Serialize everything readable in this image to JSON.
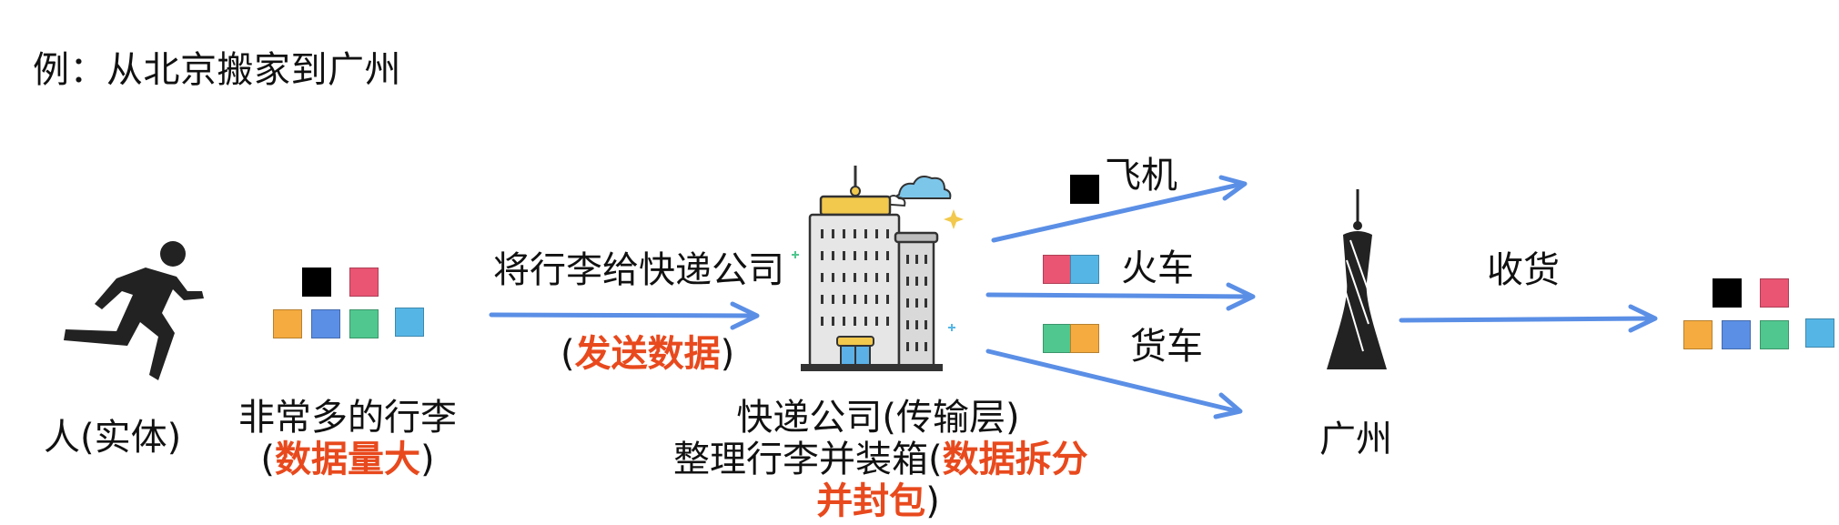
{
  "title": "例：从北京搬家到广州",
  "person": {
    "icon": "running-person-icon",
    "label": "人(实体)"
  },
  "luggage": {
    "label_line1": "非常多的行李",
    "label_open": "(",
    "label_highlight": "数据量大",
    "label_close": ")"
  },
  "step_give": {
    "label": "将行李给快递公司",
    "sub_open": "(",
    "sub_highlight": "发送数据",
    "sub_close": ")"
  },
  "courier": {
    "icon": "office-building-icon",
    "line1": "快递公司(传输层)",
    "line2_prefix": "整理行李并装箱(",
    "line2_highlight": "数据拆分",
    "line3_highlight": "并封包",
    "line3_close": ")"
  },
  "routes": {
    "plane": "飞机",
    "train": "火车",
    "truck": "货车"
  },
  "destination": {
    "icon": "canton-tower-icon",
    "label": "广州"
  },
  "receive": {
    "label": "收货"
  },
  "colors": {
    "black": "#000000",
    "red": "#e95573",
    "orange": "#f5ab3f",
    "blue": "#5b8fe6",
    "green": "#50c78f",
    "cyan": "#55b6e6",
    "arrow": "#5b8fe6",
    "highlight": "#e8491d"
  }
}
